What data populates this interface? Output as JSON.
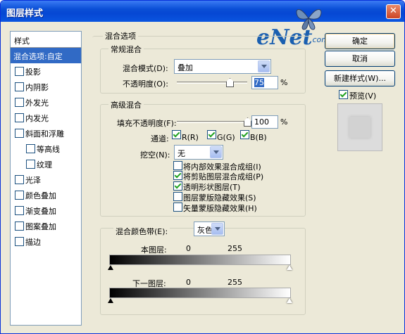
{
  "window": {
    "title": "图层样式",
    "close_glyph": "✕"
  },
  "watermark": {
    "brand": "eNet",
    "url": ".com.cn/eschool"
  },
  "styles_panel": {
    "header": "样式",
    "items": [
      {
        "label": "混合选项:自定",
        "selected": true,
        "checkbox": false
      },
      {
        "label": "投影",
        "checkbox": true,
        "checked": false
      },
      {
        "label": "内阴影",
        "checkbox": true,
        "checked": false
      },
      {
        "label": "外发光",
        "checkbox": true,
        "checked": false
      },
      {
        "label": "内发光",
        "checkbox": true,
        "checked": false
      },
      {
        "label": "斜面和浮雕",
        "checkbox": true,
        "checked": false
      },
      {
        "label": "等高线",
        "checkbox": true,
        "checked": false,
        "indent": true
      },
      {
        "label": "纹理",
        "checkbox": true,
        "checked": false,
        "indent": true
      },
      {
        "label": "光泽",
        "checkbox": true,
        "checked": false
      },
      {
        "label": "颜色叠加",
        "checkbox": true,
        "checked": false
      },
      {
        "label": "渐变叠加",
        "checkbox": true,
        "checked": false
      },
      {
        "label": "图案叠加",
        "checkbox": true,
        "checked": false
      },
      {
        "label": "描边",
        "checkbox": true,
        "checked": false
      }
    ]
  },
  "blend_options": {
    "title": "混合选项",
    "general": {
      "title": "常规混合",
      "mode_label": "混合模式(D):",
      "mode_value": "叠加",
      "opacity_label": "不透明度(O):",
      "opacity_value": "75",
      "opacity_unit": "%",
      "opacity_fraction": 0.75
    },
    "advanced": {
      "title": "高级混合",
      "fill_label": "填充不透明度(F):",
      "fill_value": "100",
      "fill_unit": "%",
      "fill_fraction": 1.0,
      "channels_label": "通道:",
      "channels": [
        {
          "label": "R(R)",
          "checked": true
        },
        {
          "label": "G(G)",
          "checked": true
        },
        {
          "label": "B(B)",
          "checked": true
        }
      ],
      "knockout_label": "挖空(N):",
      "knockout_value": "无",
      "options": [
        {
          "label": "将内部效果混合成组(I)",
          "checked": false
        },
        {
          "label": "将剪贴图层混合成组(P)",
          "checked": true
        },
        {
          "label": "透明形状图层(T)",
          "checked": true
        },
        {
          "label": "图层蒙版隐藏效果(S)",
          "checked": false
        },
        {
          "label": "矢量蒙版隐藏效果(H)",
          "checked": false
        }
      ]
    },
    "blend_if": {
      "label": "混合颜色带(E):",
      "value": "灰色",
      "this_layer": {
        "label": "本图层:",
        "min": "0",
        "max": "255"
      },
      "underlying": {
        "label": "下一图层:",
        "min": "0",
        "max": "255"
      }
    }
  },
  "buttons": {
    "ok": "确定",
    "cancel": "取消",
    "new_style": "新建样式(W)...",
    "preview_label": "预览(V)",
    "preview_checked": true
  }
}
